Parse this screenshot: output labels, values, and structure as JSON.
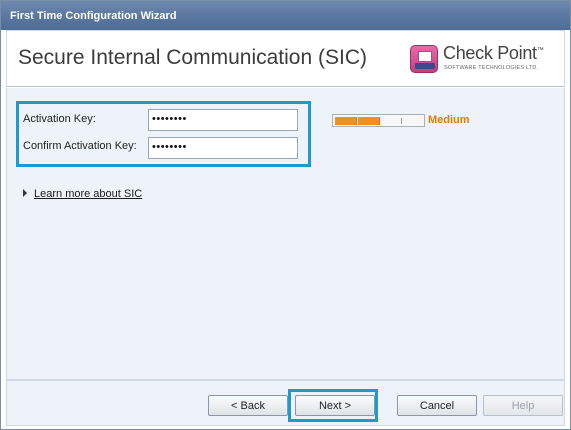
{
  "window": {
    "title": "First Time Configuration Wizard"
  },
  "header": {
    "title": "Secure Internal Communication (SIC)",
    "logo": {
      "name": "Check Point",
      "tm": "™",
      "tagline": "SOFTWARE TECHNOLOGIES LTD."
    }
  },
  "form": {
    "activation_key": {
      "label": "Activation Key:",
      "value": "••••••••"
    },
    "confirm_key": {
      "label": "Confirm Activation Key:",
      "value": "••••••••"
    },
    "strength": {
      "label": "Medium",
      "level": 0.5,
      "color": "#f0901e",
      "label_color": "#e07b0c"
    }
  },
  "links": {
    "learn_more": "Learn more about SIC"
  },
  "buttons": {
    "back": "< Back",
    "next": "Next >",
    "cancel": "Cancel",
    "help": "Help"
  },
  "colors": {
    "highlight": "#1d9bd1",
    "titlebar": "#5a779f",
    "content_bg": "#eef3f9"
  }
}
